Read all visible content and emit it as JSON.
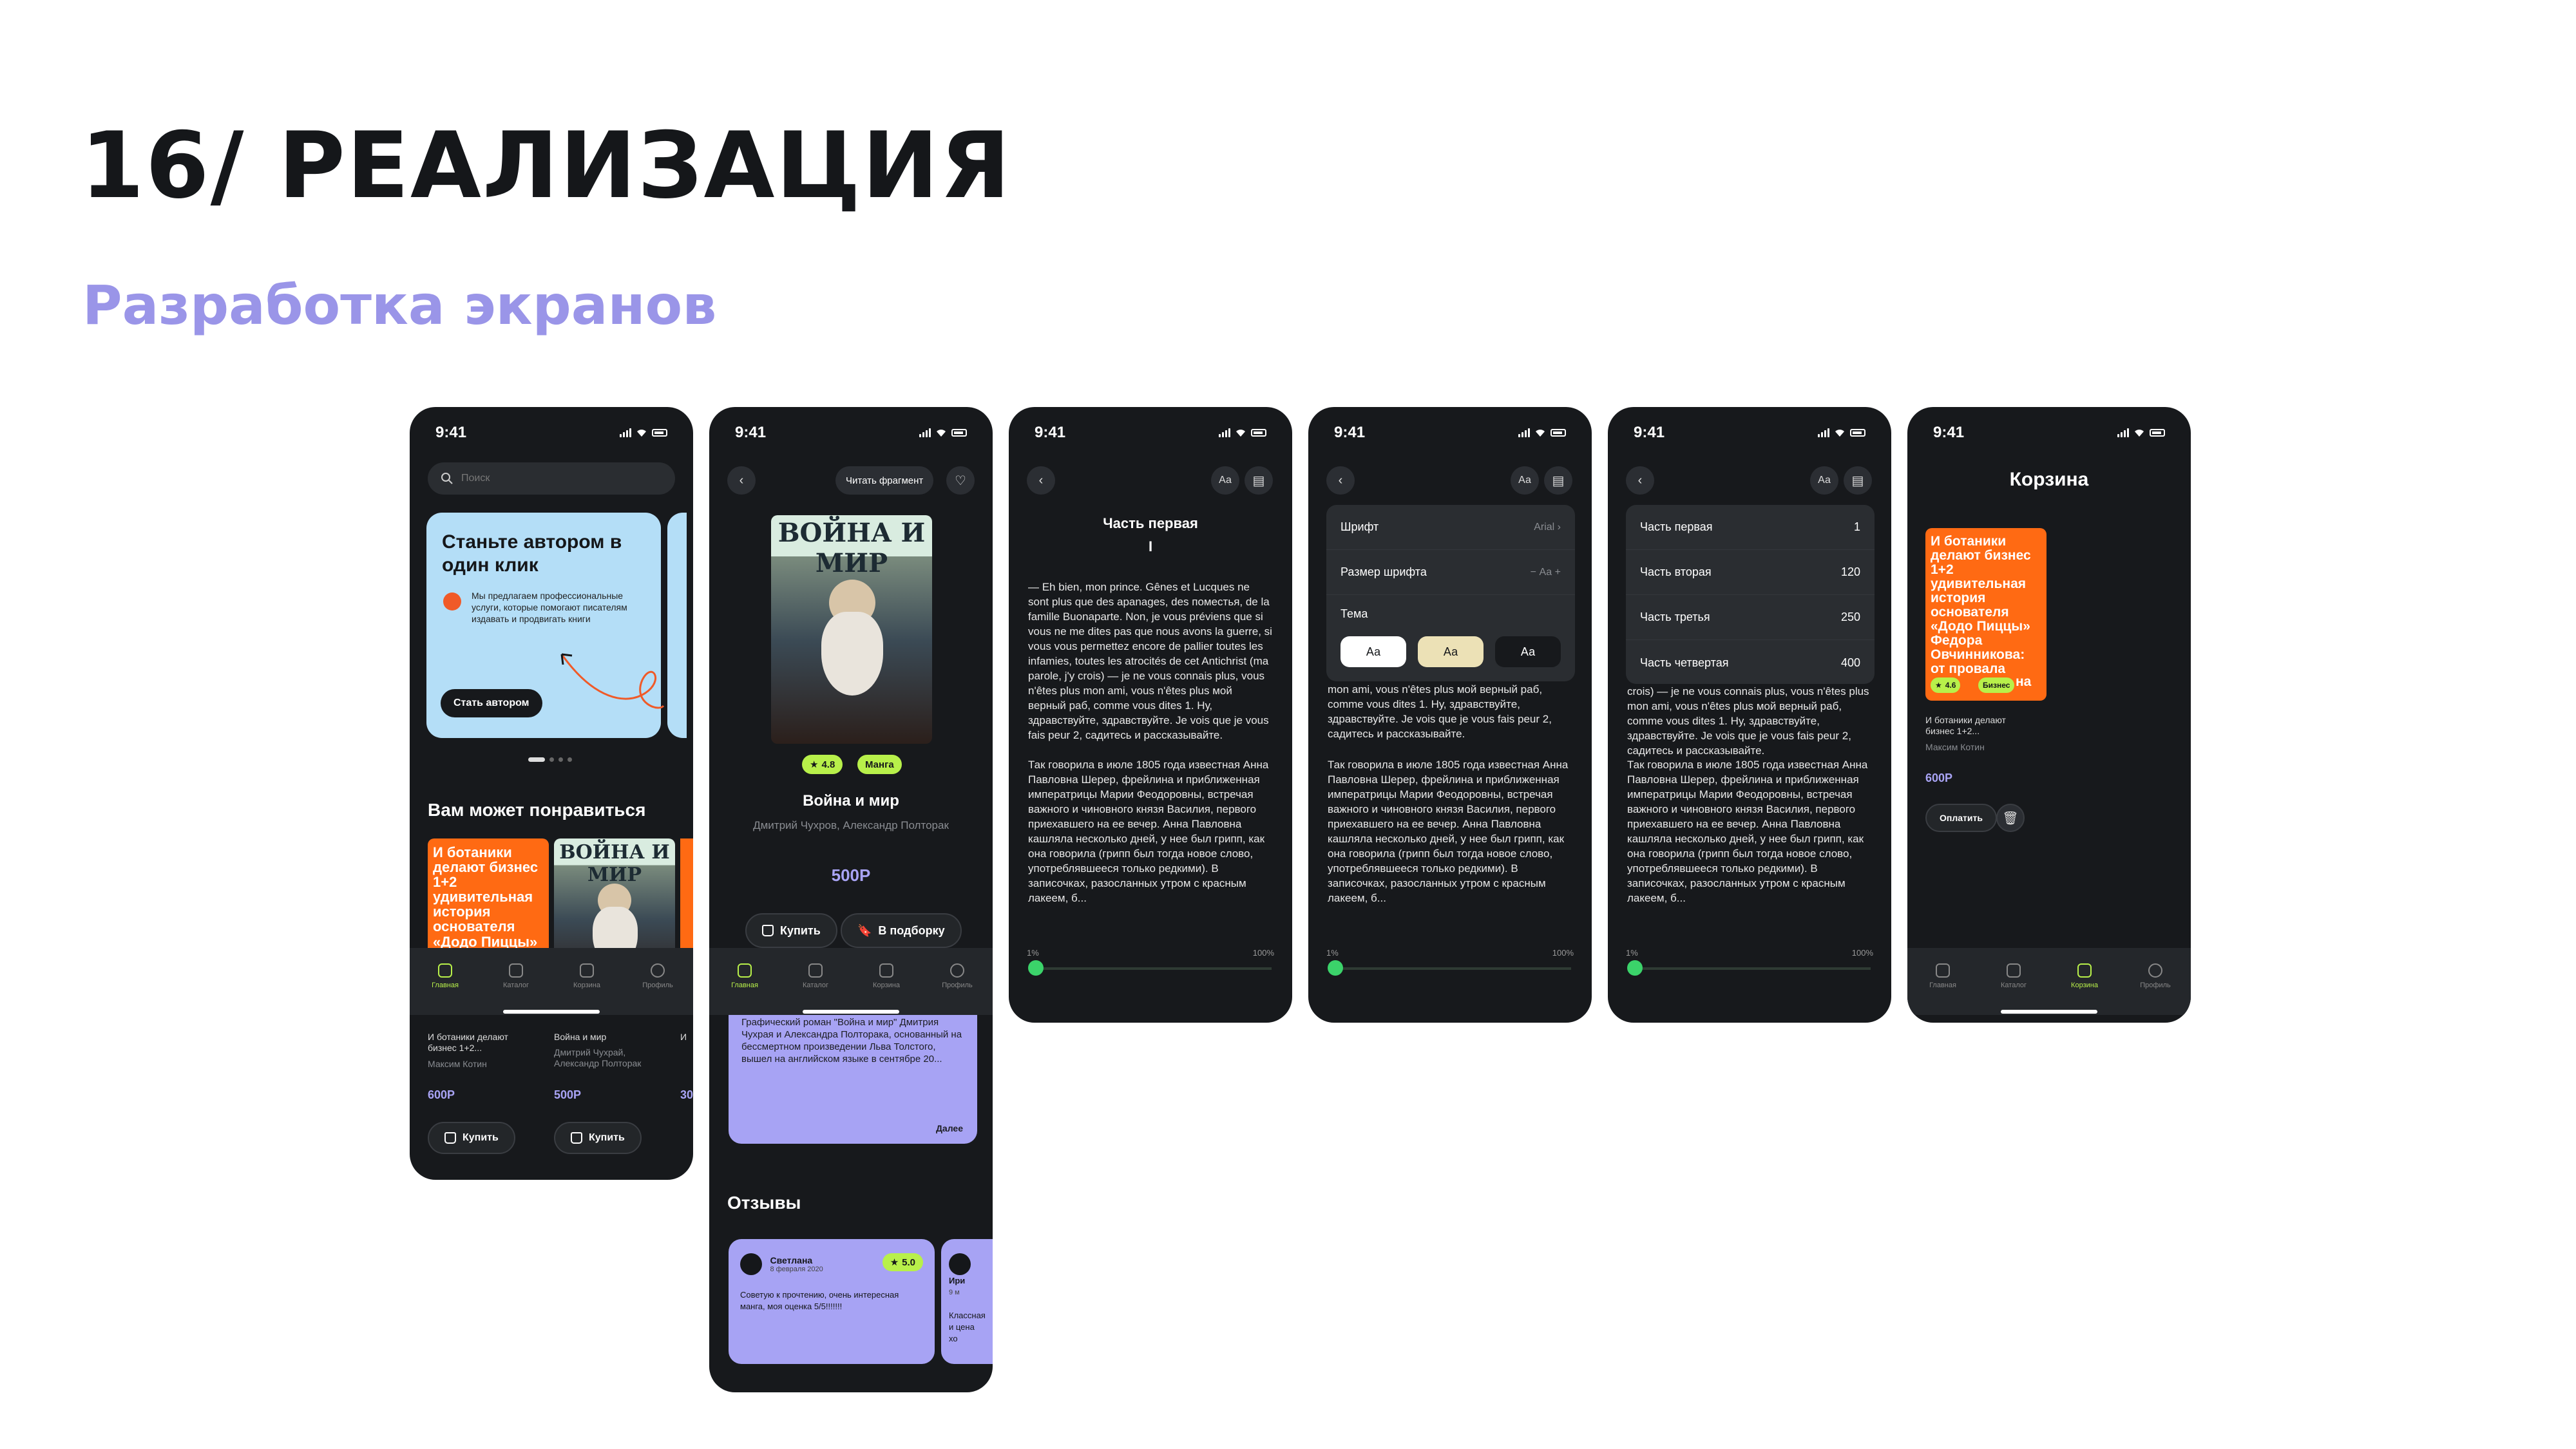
{
  "page": {
    "title": "16/ РЕАЛИЗАЦИЯ",
    "subtitle": "Разработка экранов"
  },
  "status": {
    "time": "9:41"
  },
  "home": {
    "search_placeholder": "Поиск",
    "banner_title": "Станьте автором в один клик",
    "banner_text": "Мы предлагаем профессиональные услуги, которые помогают писателям издавать и продвигать книги",
    "banner_button": "Стать автором",
    "section": "Вам может понравиться",
    "cards": [
      {
        "cover": "И ботаники делают бизнес 1+2 удивительная история основателя «Додо Пиццы»",
        "title": "И ботаники делают бизнес 1+2...",
        "author": "Максим Котин",
        "price": "600Р",
        "buy": "Купить"
      },
      {
        "cover": "ВОЙНА И МИР",
        "title": "Война и мир",
        "author": "Дмитрий Чухрай, Александр Полторак",
        "price": "500Р",
        "buy": "Купить"
      }
    ],
    "peek": "И",
    "peek_price": "30"
  },
  "nav": {
    "home": "Главная",
    "catalog": "Каталог",
    "cart": "Корзина",
    "profile": "Профиль"
  },
  "book": {
    "read_fragment": "Читать фрагмент",
    "cover_title": "ВОЙНА И МИР",
    "rating": "4.8",
    "genre": "Манга",
    "title": "Война и мир",
    "authors": "Дмитрий Чухров, Александр Полторак",
    "price": "500Р",
    "buy": "Купить",
    "add": "В подборку",
    "desc": "Графический роман \"Война и мир\" Дмитрия Чухрая и Александра Полторака, основанный на бессмертном произведении Льва Толстого, вышел на английском языке в сентябре 20...",
    "more": "Далее",
    "reviews_title": "Отзывы",
    "review": {
      "name": "Светлана",
      "date": "8 февраля 2020",
      "rating": "5.0",
      "text": "Советую к прочтению, очень интересная манга, моя оценка 5/5!!!!!!!"
    },
    "review2": {
      "name": "Ири",
      "date": "9 м",
      "text": "Классная и цена хо"
    }
  },
  "reader": {
    "font_btn": "Аа",
    "part": "Часть первая",
    "roman": "I",
    "text": "— Eh bien, mon prince. Gênes et Lucques ne sont plus que des apanages, des поместья, de la famille Buonaparte. Non, je vous préviens que si vous ne me dites pas que nous avons la guerre, si vous vous permettez encore de pallier toutes les infamies, toutes les atrocités de cet Antichrist (ma parole, j'y crois) — je ne vous connais plus, vous n'êtes plus mon ami, vous n'êtes plus мой верный раб, comme vous dites 1. Ну, здравствуйте, здравствуйте. Je vois que je vous fais peur 2, садитесь и рассказывайте.",
    "text2": "Так говорила в июле 1805 года известная Анна Павловна Шерер, фрейлина и приближенная императрицы Марии Феодоровны, встречая важного и чиновного князя Василия, первого приехавшего на ее вечер. Анна Павловна кашляла несколько дней, у нее был грипп, как она говорила (грипп был тогда новое слово, употреблявшееся только редкими). В записочках, разосланных утром с красным лакеем, б...",
    "text_short": "crois) — je ne vous connais plus, vous n'êtes plus mon ami, vous n'êtes plus мой верный раб, comme vous dites 1. Ну, здравствуйте, здравствуйте. Je vois que je vous fais peur 2, садитесь и рассказывайте.",
    "progress_start": "1%",
    "progress_end": "100%",
    "progress_value": 0.01
  },
  "settings": {
    "font_label": "Шрифт",
    "font_value": "Arial",
    "size_label": "Размер шрифта",
    "size_value": "Аа",
    "size_minus": "−",
    "size_plus": "+",
    "theme_label": "Тема",
    "theme_opts": [
      "Аа",
      "Аа",
      "Аа"
    ]
  },
  "contents": [
    {
      "label": "Часть первая",
      "page": "1"
    },
    {
      "label": "Часть вторая",
      "page": "120"
    },
    {
      "label": "Часть третья",
      "page": "250"
    },
    {
      "label": "Часть четвертая",
      "page": "400"
    }
  ],
  "cart": {
    "title": "Корзина",
    "cover": "И ботаники делают бизнес 1+2 удивительная история основателя «Додо Пиццы» Федора Овчинникова: от провала",
    "cover_tail": "на",
    "rating": "4.6",
    "genre": "Бизнес",
    "item_title": "И ботаники делают бизнес 1+2...",
    "author": "Максим Котин",
    "price": "600Р",
    "pay": "Оплатить"
  },
  "colors": {
    "accent": "#9a95e8",
    "lime": "#b8f04a",
    "orange": "#ff6a13",
    "dark": "#17191c",
    "green": "#3bd36a"
  }
}
